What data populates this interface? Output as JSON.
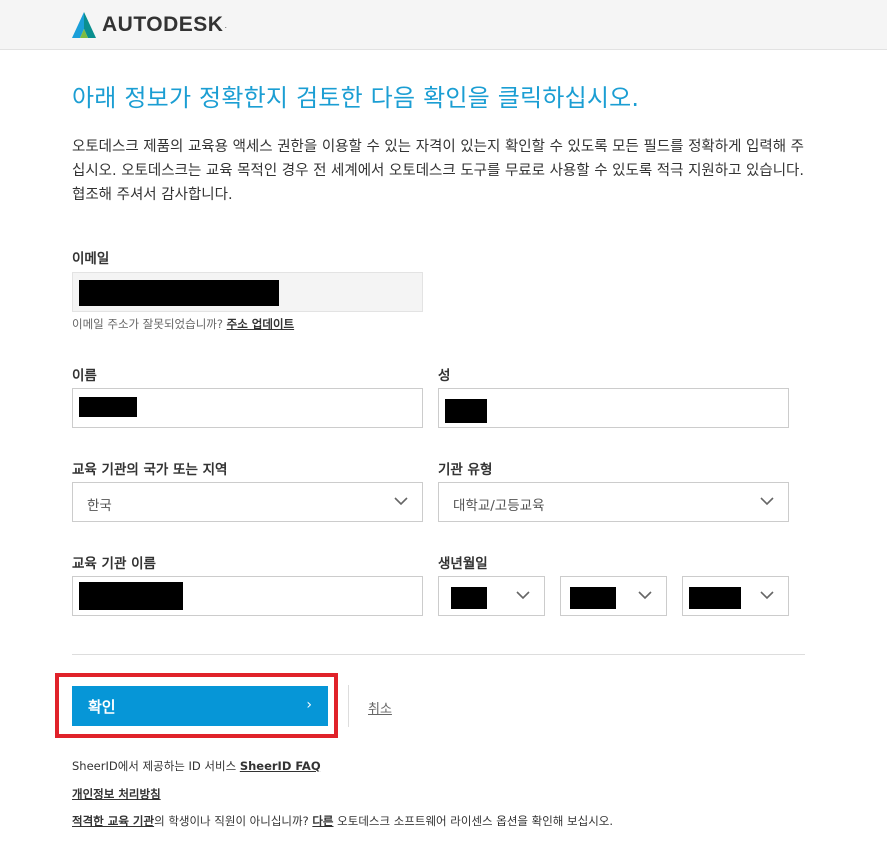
{
  "header": {
    "brand": "AUTODESK",
    "brand_mark": "."
  },
  "heading": "아래 정보가 정확한지 검토한 다음 확인을 클릭하십시오.",
  "intro": "오토데스크 제품의 교육용 액세스 권한을 이용할 수 있는 자격이 있는지 확인할 수 있도록 모든 필드를 정확하게 입력해 주십시오. 오토데스크는 교육 목적인 경우 전 세계에서 오토데스크 도구를 무료로 사용할 수 있도록 적극 지원하고 있습니다. 협조해 주셔서 감사합니다.",
  "form": {
    "email_label": "이메일",
    "email_hint": "이메일 주소가 잘못되었습니까?",
    "email_update_link": "주소 업데이트",
    "first_name_label": "이름",
    "last_name_label": "성",
    "country_label": "교육 기관의 국가 또는 지역",
    "country_value": "한국",
    "institution_type_label": "기관 유형",
    "institution_type_value": "대학교/고등교육",
    "institution_name_label": "교육 기관 이름",
    "birthdate_label": "생년월일"
  },
  "actions": {
    "confirm_label": "확인",
    "confirm_arrow": "›",
    "cancel_label": "취소"
  },
  "footer": {
    "sheerid_text": "SheerID에서 제공하는 ID 서비스",
    "sheerid_faq": "SheerID FAQ",
    "privacy": "개인정보 처리방침",
    "eligible_link": "적격한 교육 기관",
    "eligible_text": "의 학생이나 직원이 아니십니까?",
    "other_link": "다른",
    "other_text": "오토데스크 소프트웨어 라이센스 옵션을 확인해 보십시오."
  },
  "colors": {
    "accent": "#0696d7",
    "heading": "#1b9ed3",
    "highlight": "#e0222a"
  }
}
